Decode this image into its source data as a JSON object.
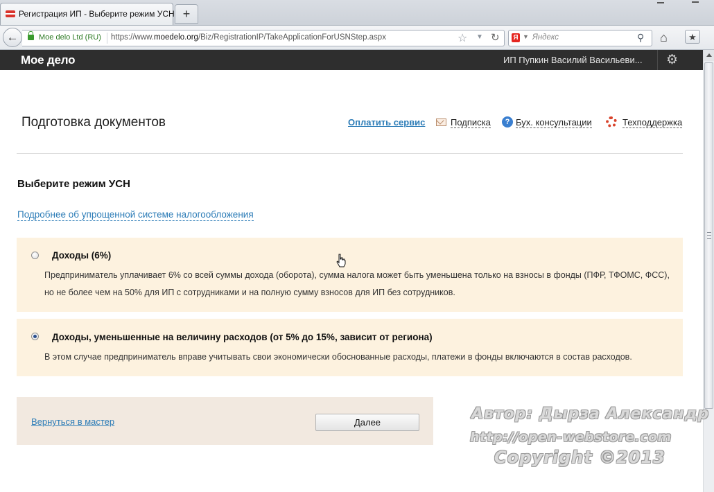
{
  "browser": {
    "tab_title": "Регистрация ИП - Выберите режим УСН",
    "new_tab_label": "+",
    "site_identity": "Moe delo Ltd (RU)",
    "url_prefix": "https://www.",
    "url_domain": "moedelo.org",
    "url_path": "/Biz/RegistrationIP/TakeApplicationForUSNStep.aspx",
    "search_engine_logo": "Я",
    "search_placeholder": "Яндекс",
    "icons": [
      "back-arrow-icon",
      "lock-icon",
      "star-icon",
      "dropdown-icon",
      "reload-icon",
      "search-icon",
      "home-icon",
      "bookmarks-icon"
    ]
  },
  "app": {
    "logo": "Мое дело",
    "user_name": "ИП Пупкин Василий Васильеви...",
    "settings_icon": "gear-icon"
  },
  "page": {
    "title": "Подготовка документов",
    "pay_link": "Оплатить сервис",
    "nav": {
      "subscription": "Подписка",
      "accounting_consult": "Бух. консультации",
      "support": "Техподдержка"
    },
    "section_title": "Выберите режим УСН",
    "info_link": "Подробнее об упрощенной системе налогообложения",
    "options": [
      {
        "title": "Доходы (6%)",
        "description": "Предприниматель уплачивает 6% со всей суммы дохода (оборота), сумма налога может быть уменьшена только на взносы в фонды (ПФР, ТФОМС, ФСС), но не более чем на 50% для ИП с сотрудниками и на полную сумму взносов для ИП без сотрудников.",
        "selected": false
      },
      {
        "title": "Доходы, уменьшенные на величину расходов (от 5% до 15%, зависит от региона)",
        "description": "В этом случае предприниматель вправе учитывать свои экономически обоснованные расходы, платежи в фонды включаются в состав расходов.",
        "selected": true
      }
    ],
    "back_link": "Вернуться в мастер",
    "next_button": "Далее"
  },
  "watermark": {
    "line1": "Автор: Дырза Александр",
    "line2": "http://open-webstore.com",
    "line3": "Copyright ©2013"
  },
  "colors": {
    "header_bg": "#2e2e2e",
    "link": "#2c7cb7",
    "option_bg": "#fdf2df",
    "footer_bg": "#f2e9e0"
  }
}
